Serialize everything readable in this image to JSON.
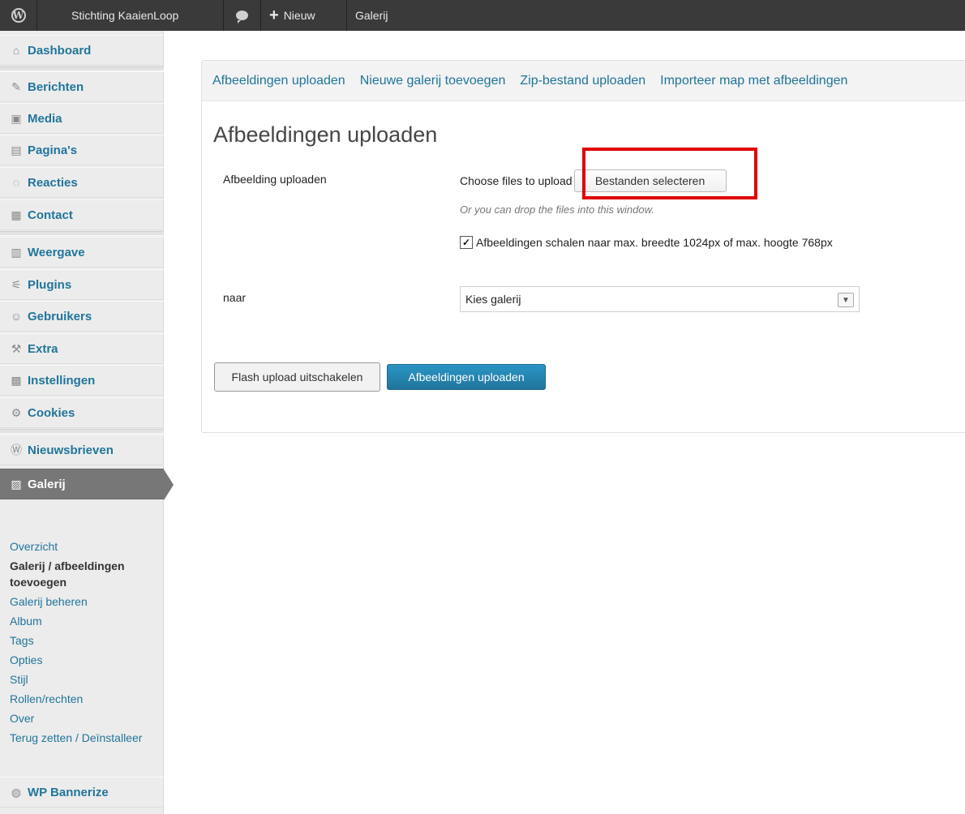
{
  "adminbar": {
    "site_name": "Stichting KaaienLoop",
    "new_label": "Nieuw",
    "gallery_label": "Galerij"
  },
  "sidebar": {
    "items": [
      {
        "label": "Dashboard",
        "icon": "house-icon"
      },
      {
        "label": "Berichten",
        "icon": "pin-icon"
      },
      {
        "label": "Media",
        "icon": "media-icon"
      },
      {
        "label": "Pagina's",
        "icon": "pages-icon"
      },
      {
        "label": "Reacties",
        "icon": "comment-icon"
      },
      {
        "label": "Contact",
        "icon": "contact-icon"
      },
      {
        "label": "Weergave",
        "icon": "appearance-icon"
      },
      {
        "label": "Plugins",
        "icon": "plug-icon"
      },
      {
        "label": "Gebruikers",
        "icon": "users-icon"
      },
      {
        "label": "Extra",
        "icon": "tools-icon"
      },
      {
        "label": "Instellingen",
        "icon": "settings-icon"
      },
      {
        "label": "Cookies",
        "icon": "gear-icon"
      },
      {
        "label": "Nieuwsbrieven",
        "icon": "wordpress-icon"
      },
      {
        "label": "Galerij",
        "icon": "gallery-icon"
      }
    ],
    "submenu": [
      "Overzicht",
      "Galerij / afbeeldingen toevoegen",
      "Galerij beheren",
      "Album",
      "Tags",
      "Opties",
      "Stijl",
      "Rollen/rechten",
      "Over",
      "Terug zetten / Deïnstalleer"
    ],
    "bottom_item": "WP Bannerize"
  },
  "tabs": [
    "Afbeeldingen uploaden",
    "Nieuwe galerij toevoegen",
    "Zip-bestand uploaden",
    "Importeer map met afbeeldingen"
  ],
  "main": {
    "title": "Afbeeldingen uploaden",
    "upload_label": "Afbeelding uploaden",
    "choose_text": "Choose files to upload",
    "select_button": "Bestanden selecteren",
    "drop_hint": "Or you can drop the files into this window.",
    "resize_label": "Afbeeldingen schalen naar max. breedte 1024px of max. hoogte 768px",
    "resize_checked": true,
    "to_label": "naar",
    "gallery_select": "Kies galerij",
    "flash_button": "Flash upload uitschakelen",
    "upload_button": "Afbeeldingen uploaden"
  },
  "colors": {
    "link": "#21759b",
    "highlight": "#e00000",
    "primary_button": "#21759b",
    "adminbar": "#3a3a3a"
  }
}
